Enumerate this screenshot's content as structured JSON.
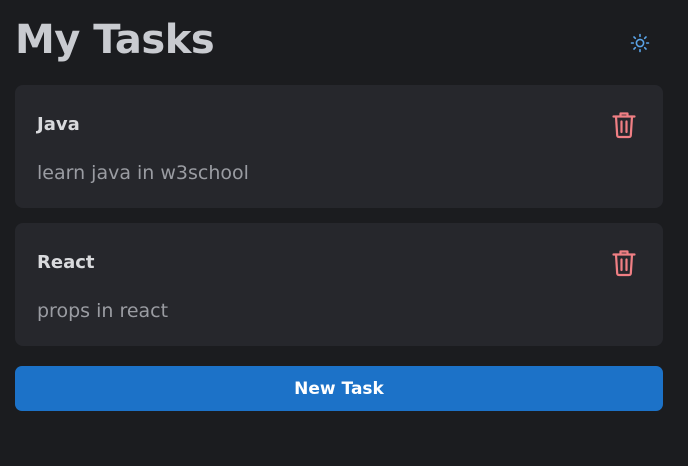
{
  "header": {
    "title": "My Tasks",
    "theme_toggle_icon": "sun-icon"
  },
  "tasks": [
    {
      "title": "Java",
      "description": "learn java in w3school",
      "delete_icon": "trash-icon"
    },
    {
      "title": "React",
      "description": "props in react",
      "delete_icon": "trash-icon"
    }
  ],
  "actions": {
    "new_task_label": "New Task"
  },
  "colors": {
    "background": "#1b1c1f",
    "card": "#26272c",
    "accent": "#1c72c8",
    "delete": "#f07f84",
    "theme_icon": "#5aa4e8"
  }
}
